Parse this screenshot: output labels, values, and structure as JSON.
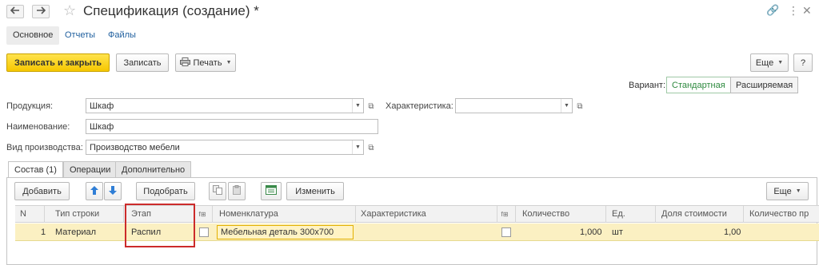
{
  "window": {
    "title": "Спецификация (создание) *",
    "icons": [
      "arrow-left-icon",
      "arrow-right-icon",
      "star-icon",
      "link-icon",
      "more-icon",
      "close-icon"
    ]
  },
  "tabs": [
    "Основное",
    "Отчеты",
    "Файлы"
  ],
  "toolbar": {
    "save_close": "Записать и закрыть",
    "save": "Записать",
    "print": "Печать",
    "more": "Еще",
    "help": "?"
  },
  "variant": {
    "label": "Вариант:",
    "options": [
      "Стандартная",
      "Расширяемая"
    ],
    "selected": "Стандартная"
  },
  "form": {
    "product_label": "Продукция:",
    "product_value": "Шкаф",
    "characteristic_label": "Характеристика:",
    "characteristic_value": "",
    "name_label": "Наименование:",
    "name_value": "Шкаф",
    "production_type_label": "Вид производства:",
    "production_type_value": "Производство мебели"
  },
  "inner_tabs": [
    "Состав (1)",
    "Операции",
    "Дополнительно"
  ],
  "table_toolbar": {
    "add": "Добавить",
    "pick": "Подобрать",
    "change": "Изменить",
    "more": "Еще"
  },
  "table": {
    "columns": [
      "N",
      "Тип строки",
      "Этап",
      "Номенклатура",
      "Характеристика",
      "Количество",
      "Ед.",
      "Доля стоимости",
      "Количество пр"
    ],
    "rows": [
      {
        "n": "1",
        "row_type": "Материал",
        "stage": "Распил",
        "nomenclature": "Мебельная деталь 300х700",
        "characteristic": "",
        "quantity": "1,000",
        "unit": "шт",
        "cost_share": "1,00",
        "quantity_pr": ""
      }
    ]
  },
  "colors": {
    "primary_button": "#f6c700",
    "selected_row": "#fbf0c2",
    "highlight_border": "#cc2b2b",
    "link": "#1f5f9e",
    "variant_active": "#2e8a3f"
  }
}
